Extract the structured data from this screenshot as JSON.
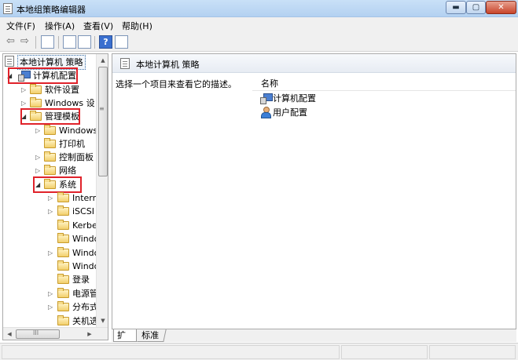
{
  "window": {
    "title": "本地组策略编辑器",
    "min": "▬",
    "max": "▢",
    "close": "✕"
  },
  "menu": [
    "文件(F)",
    "操作(A)",
    "查看(V)",
    "帮助(H)"
  ],
  "toolbar": {
    "back": "⇦",
    "forward": "⇨",
    "help": "?"
  },
  "tree": {
    "root": "本地计算机 策略",
    "computer_config": "计算机配置",
    "software_settings": "软件设置",
    "windows_settings": "Windows 设",
    "admin_templates": "管理模板",
    "windows_components": "Windows",
    "printers": "打印机",
    "control_panel": "控制面板",
    "network": "网络",
    "system": "系统",
    "system_children": [
      "Intern",
      "iSCSI",
      "Kerbe",
      "Windo",
      "Windo",
      "Windo",
      "登录",
      "电源管",
      "分布式",
      "关机选"
    ],
    "system_children_expandable": [
      true,
      true,
      false,
      false,
      true,
      false,
      false,
      true,
      true,
      false
    ]
  },
  "scroll": {
    "up": "▲",
    "down": "▼",
    "left": "◀",
    "right": "▶",
    "vgrip": "≡",
    "hgrip": "III"
  },
  "right": {
    "header": "本地计算机 策略",
    "description": "选择一个项目来查看它的描述。",
    "column_name": "名称",
    "items": [
      "计算机配置",
      "用户配置"
    ]
  },
  "tabs": [
    "扩展",
    "标准"
  ],
  "accent": {
    "highlight": "#e0222a",
    "folder": "#f2cf6b"
  }
}
